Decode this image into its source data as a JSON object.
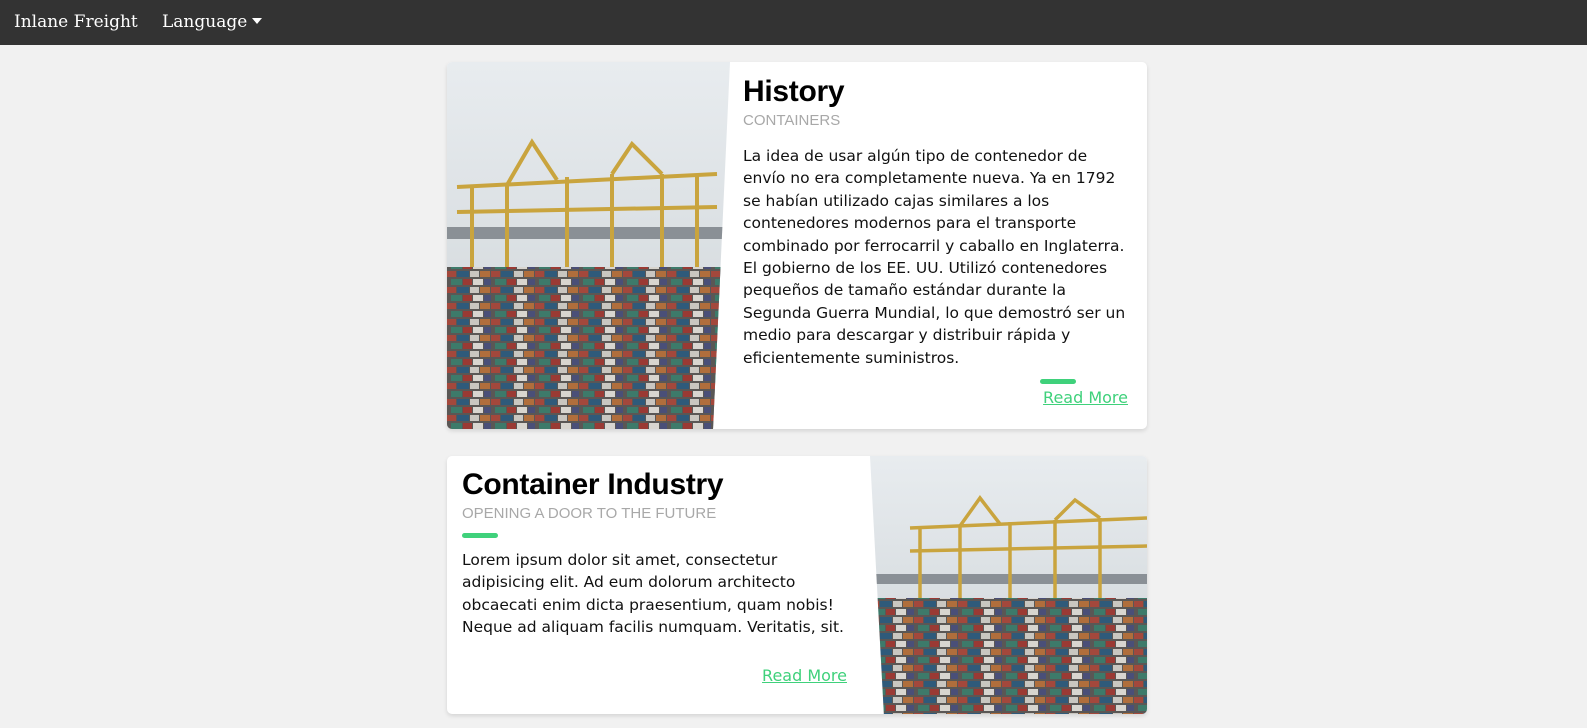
{
  "navbar": {
    "brand": "Inlane Freight",
    "language_label": "Language"
  },
  "cards": [
    {
      "title": "History",
      "subtitle": "CONTAINERS",
      "text": "La idea de usar algún tipo de contenedor de envío no era completamente nueva. Ya en 1792 se habían utilizado cajas similares a los contenedores modernos para el transporte combinado por ferrocarril y caballo en Inglaterra. El gobierno de los EE. UU. Utilizó contenedores pequeños de tamaño estándar durante la Segunda Guerra Mundial, lo que demostró ser un medio para descargar y distribuir rápida y eficientemente suministros.",
      "link": "Read More",
      "image": "container-port-cranes-photo"
    },
    {
      "title": "Container Industry",
      "subtitle": "OPENING A DOOR TO THE FUTURE",
      "text": "Lorem ipsum dolor sit amet, consectetur adipisicing elit. Ad eum dolorum architecto obcaecati enim dicta praesentium, quam nobis! Neque ad aliquam facilis numquam. Veritatis, sit.",
      "link": "Read More",
      "image": "container-port-cranes-photo"
    }
  ],
  "colors": {
    "navbar": "#333333",
    "background": "#f1f1f1",
    "accent": "#3fd17b"
  }
}
